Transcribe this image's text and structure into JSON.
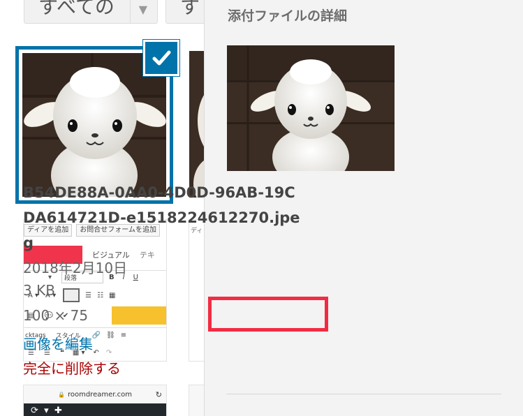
{
  "toolbar": {
    "filter_media_label": "すべての",
    "filter_date_label": "す"
  },
  "editor_screenshot": {
    "add_media": "ディアを追加",
    "contact_form": "お問合せフォームを追加",
    "tab_visual": "ビジュアル",
    "tab_text": "テキ",
    "format_select": "段落",
    "style_select": "スタイル",
    "tags_label": "cktags",
    "add_media_2": "ディ"
  },
  "browser_screenshot": {
    "url": "roomdreamer.com"
  },
  "details": {
    "title": "添付ファイルの詳細",
    "filename": "B54DE88A-0AA0-4D0D-96AB-19CDA614721D-e1518224612270.jpeg",
    "date": "2018年2月10日",
    "size": "3 KB",
    "dimensions": "100 × 75",
    "edit_link": "画像を編集",
    "delete_link": "完全に削除する"
  },
  "colors": {
    "accent": "#0073aa",
    "highlight": "#f32b42",
    "delete": "#aa0000",
    "panel_bg": "#f3f3f3"
  }
}
